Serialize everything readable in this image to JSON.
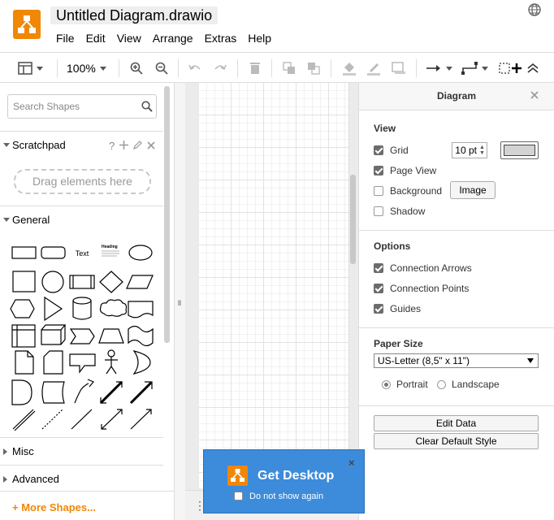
{
  "app": {
    "title": "Untitled Diagram.drawio",
    "brand_color": "#f08705"
  },
  "menu": [
    "File",
    "Edit",
    "View",
    "Arrange",
    "Extras",
    "Help"
  ],
  "toolbar": {
    "zoom": "100%",
    "icons": [
      "view-layout-icon",
      "zoom-in-icon",
      "zoom-out-icon",
      "undo-icon",
      "redo-icon",
      "delete-icon",
      "to-front-icon",
      "to-back-icon",
      "fill-color-icon",
      "line-color-icon",
      "shadow-icon",
      "connection-arrow-icon",
      "waypoint-icon",
      "fullscreen-icon",
      "collapse-icon"
    ]
  },
  "sidebar": {
    "search_placeholder": "Search Shapes",
    "scratchpad_label": "Scratchpad",
    "scratchpad_help": "?",
    "drop_text": "Drag elements here",
    "general_label": "General",
    "misc_label": "Misc",
    "advanced_label": "Advanced",
    "more_shapes": "More Shapes...",
    "sample_text_shape": "Text",
    "heading_shape": "Heading"
  },
  "format_panel": {
    "title": "Diagram",
    "view_title": "View",
    "grid_label": "Grid",
    "grid_size": "10 pt",
    "grid_color": "#d3d3d3",
    "page_view_label": "Page View",
    "background_label": "Background",
    "image_button": "Image",
    "shadow_label": "Shadow",
    "options_title": "Options",
    "connection_arrows_label": "Connection Arrows",
    "connection_points_label": "Connection Points",
    "guides_label": "Guides",
    "paper_size_title": "Paper Size",
    "paper_size_value": "US-Letter (8,5\" x 11\")",
    "portrait_label": "Portrait",
    "landscape_label": "Landscape",
    "edit_data_button": "Edit Data",
    "clear_style_button": "Clear Default Style"
  },
  "popup": {
    "title": "Get Desktop",
    "checkbox_label": "Do not show again",
    "close": "×"
  }
}
